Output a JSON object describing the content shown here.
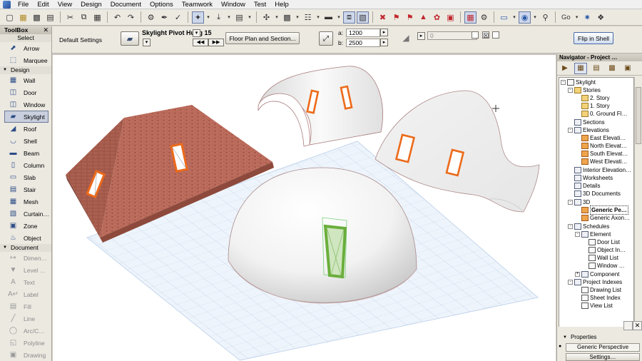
{
  "menu": [
    "File",
    "Edit",
    "View",
    "Design",
    "Document",
    "Options",
    "Teamwork",
    "Window",
    "Test",
    "Help"
  ],
  "toolbox": {
    "title": "ToolBox",
    "select_label": "Select",
    "select_tools": [
      {
        "label": "Arrow",
        "icon": "arrow-icon"
      },
      {
        "label": "Marquee",
        "icon": "marquee-icon"
      }
    ],
    "design_label": "Design",
    "design_tools": [
      {
        "label": "Wall",
        "icon": "wall-icon"
      },
      {
        "label": "Door",
        "icon": "door-icon"
      },
      {
        "label": "Window",
        "icon": "window-icon"
      },
      {
        "label": "Skylight",
        "icon": "skylight-icon",
        "selected": true
      },
      {
        "label": "Roof",
        "icon": "roof-icon"
      },
      {
        "label": "Shell",
        "icon": "shell-icon"
      },
      {
        "label": "Beam",
        "icon": "beam-icon"
      },
      {
        "label": "Column",
        "icon": "column-icon"
      },
      {
        "label": "Slab",
        "icon": "slab-icon"
      },
      {
        "label": "Stair",
        "icon": "stair-icon"
      },
      {
        "label": "Mesh",
        "icon": "mesh-icon"
      },
      {
        "label": "Curtain…",
        "icon": "curtain-wall-icon"
      },
      {
        "label": "Zone",
        "icon": "zone-icon"
      },
      {
        "label": "Object",
        "icon": "object-icon"
      }
    ],
    "document_label": "Document",
    "document_tools": [
      {
        "label": "Dimen…",
        "icon": "dimension-icon"
      },
      {
        "label": "Level …",
        "icon": "level-dimension-icon"
      },
      {
        "label": "Text",
        "icon": "text-icon"
      },
      {
        "label": "Label",
        "icon": "label-icon"
      },
      {
        "label": "Fill",
        "icon": "fill-icon"
      },
      {
        "label": "Line",
        "icon": "line-icon"
      },
      {
        "label": "Arc/C…",
        "icon": "arc-icon"
      },
      {
        "label": "Polyline",
        "icon": "polyline-icon"
      },
      {
        "label": "Drawing",
        "icon": "drawing-icon"
      }
    ]
  },
  "infobox": {
    "default_settings": "Default Settings",
    "object_name": "Skylight Pivot Hung 15",
    "floor_plan_button": "Floor Plan and Section...",
    "a_label": "a:",
    "a_value": "1200",
    "b_label": "b:",
    "b_value": "2500",
    "angle_value": "0",
    "flip_button": "Flip in Shell"
  },
  "toolbar": {
    "go_label": "Go"
  },
  "navigator": {
    "title": "Navigator - Project …",
    "tree": [
      {
        "label": "Skylight",
        "level": 0,
        "icon": "doc",
        "exp": "-"
      },
      {
        "label": "Stories",
        "level": 1,
        "icon": "folder",
        "exp": "-"
      },
      {
        "label": "2. Story",
        "level": 2,
        "icon": "folder"
      },
      {
        "label": "1. Story",
        "level": 2,
        "icon": "folder"
      },
      {
        "label": "0. Ground Fl…",
        "level": 2,
        "icon": "folder"
      },
      {
        "label": "Sections",
        "level": 1,
        "icon": "plain"
      },
      {
        "label": "Elevations",
        "level": 1,
        "icon": "plain",
        "exp": "-"
      },
      {
        "label": "East Elevati…",
        "level": 2,
        "icon": "elev"
      },
      {
        "label": "North Elevat…",
        "level": 2,
        "icon": "elev"
      },
      {
        "label": "South Elevat…",
        "level": 2,
        "icon": "elev"
      },
      {
        "label": "West Elevati…",
        "level": 2,
        "icon": "elev"
      },
      {
        "label": "Interior Elevation…",
        "level": 1,
        "icon": "plain"
      },
      {
        "label": "Worksheets",
        "level": 1,
        "icon": "plain"
      },
      {
        "label": "Details",
        "level": 1,
        "icon": "plain"
      },
      {
        "label": "3D Documents",
        "level": 1,
        "icon": "plain"
      },
      {
        "label": "3D",
        "level": 1,
        "icon": "plain",
        "exp": "-"
      },
      {
        "label": "Generic Pe…",
        "level": 2,
        "icon": "elev",
        "selected": true
      },
      {
        "label": "Generic Axon…",
        "level": 2,
        "icon": "elev"
      },
      {
        "label": "Schedules",
        "level": 1,
        "icon": "plain",
        "exp": "-"
      },
      {
        "label": "Element",
        "level": 2,
        "icon": "plain",
        "exp": "-"
      },
      {
        "label": "Door List",
        "level": 3,
        "icon": "doc"
      },
      {
        "label": "Object In…",
        "level": 3,
        "icon": "doc"
      },
      {
        "label": "Wall List",
        "level": 3,
        "icon": "doc"
      },
      {
        "label": "Window …",
        "level": 3,
        "icon": "doc"
      },
      {
        "label": "Component",
        "level": 2,
        "icon": "plain",
        "exp": "+"
      },
      {
        "label": "Project Indexes",
        "level": 1,
        "icon": "plain",
        "exp": "-"
      },
      {
        "label": "Drawing List",
        "level": 2,
        "icon": "doc"
      },
      {
        "label": "Sheet Index",
        "level": 2,
        "icon": "doc"
      },
      {
        "label": "View List",
        "level": 2,
        "icon": "doc"
      }
    ],
    "properties_label": "Properties",
    "properties_value": "Generic Perspective",
    "settings_label": "Settings…"
  }
}
